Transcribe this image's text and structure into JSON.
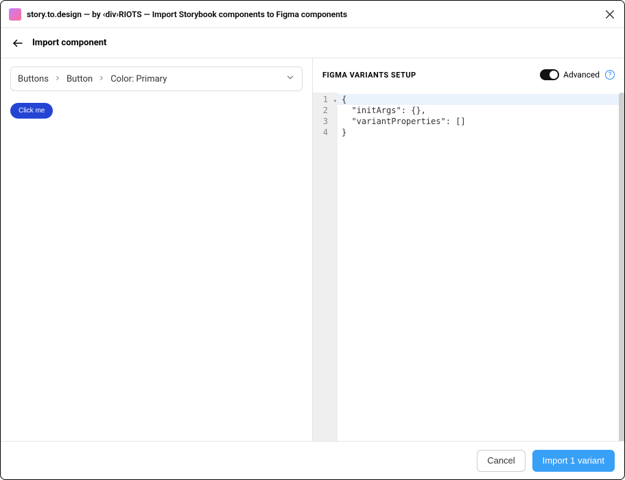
{
  "titlebar": {
    "title": "story.to.design — by ‹div›RIOTS — Import Storybook components to Figma components"
  },
  "header": {
    "title": "Import component"
  },
  "breadcrumb": {
    "items": [
      "Buttons",
      "Button",
      "Color: Primary"
    ]
  },
  "preview": {
    "button_label": "Click me"
  },
  "right": {
    "title": "FIGMA VARIANTS SETUP",
    "toggle_label": "Advanced",
    "help_glyph": "?"
  },
  "editor": {
    "line_numbers": [
      "1",
      "2",
      "3",
      "4"
    ],
    "lines": [
      "{",
      "  \"initArgs\": {},",
      "  \"variantProperties\": []",
      "}"
    ]
  },
  "footer": {
    "cancel_label": "Cancel",
    "import_label": "Import 1 variant"
  }
}
